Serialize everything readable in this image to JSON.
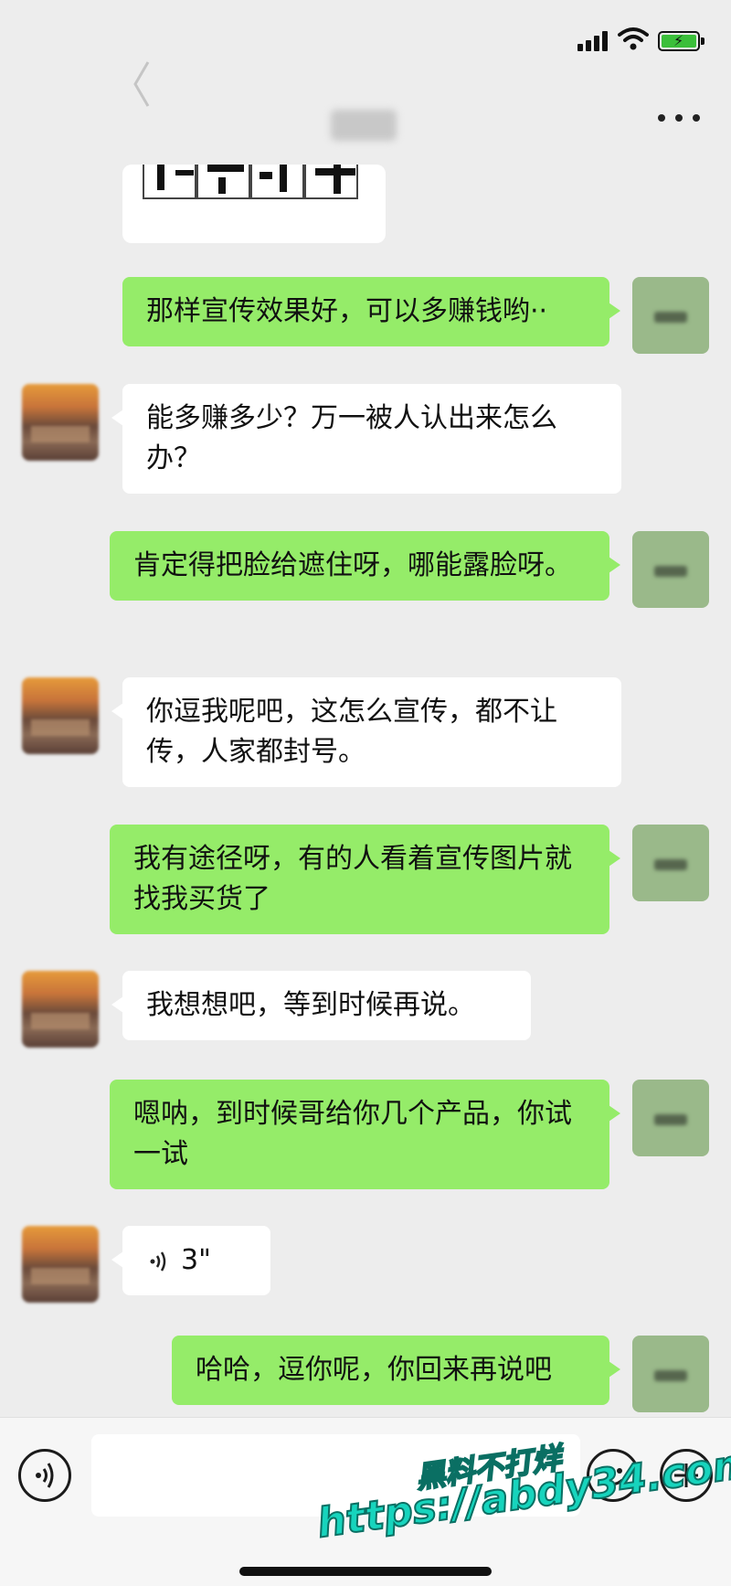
{
  "status": {
    "signal_icon": "signal-bars-icon",
    "wifi_icon": "wifi-icon",
    "battery_icon": "battery-charging-icon",
    "battery_color": "#3bbf3a"
  },
  "nav": {
    "back_icon": "chevron-left-icon",
    "more_icon": "more-dots-icon"
  },
  "colors": {
    "background": "#ededed",
    "sent_bubble": "#95ec69",
    "received_bubble": "#ffffff",
    "watermark": "#17d4bd"
  },
  "messages": [
    {
      "side": "sent",
      "text": "那样宣传效果好，可以多赚钱哟··"
    },
    {
      "side": "received",
      "text": "能多赚多少？万一被人认出来怎么办？"
    },
    {
      "side": "sent",
      "text": "肯定得把脸给遮住呀，哪能露脸呀。"
    },
    {
      "side": "received",
      "text": "你逗我呢吧，这怎么宣传，都不让传，人家都封号。"
    },
    {
      "side": "sent",
      "text": "我有途径呀，有的人看着宣传图片就找我买货了"
    },
    {
      "side": "received",
      "text": "我想想吧，等到时候再说。"
    },
    {
      "side": "sent",
      "text": "嗯呐，到时候哥给你几个产品，你试一试"
    },
    {
      "side": "received",
      "type": "voice",
      "text": "3\""
    },
    {
      "side": "sent",
      "text": "哈哈，逗你呢，你回来再说吧"
    }
  ],
  "input_bar": {
    "voice_icon": "voice-input-icon",
    "emoji_icon": "emoji-icon",
    "plus_icon": "plus-icon"
  },
  "watermark": {
    "line1": "黑料不打烊",
    "line2": "https://abdy34.com"
  }
}
